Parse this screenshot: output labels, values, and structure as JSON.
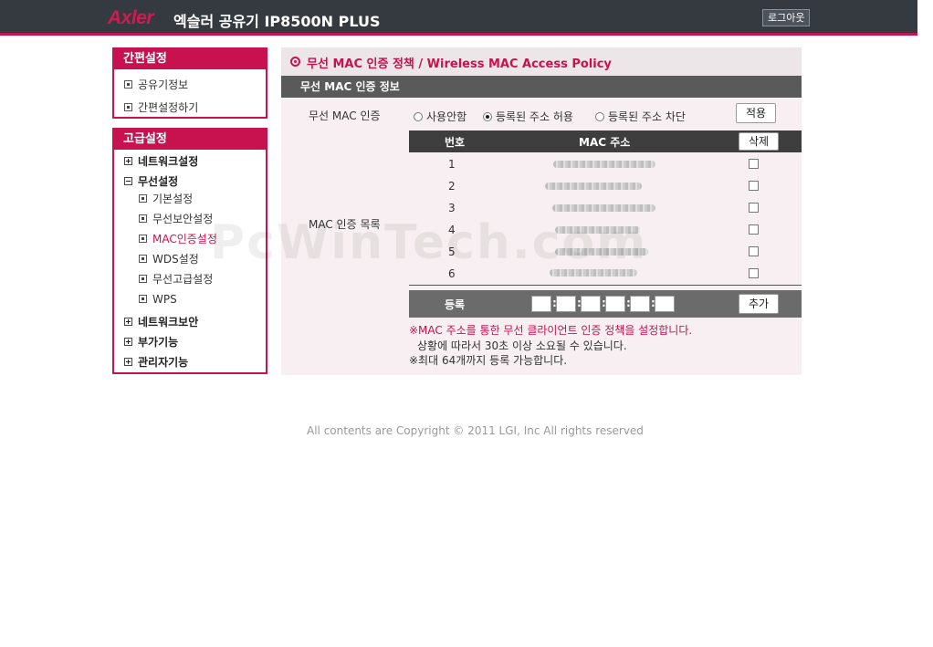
{
  "header": {
    "logo": "Axler",
    "product": "엑슬러 공유기 IP8500N PLUS",
    "logout_label": "로그아웃"
  },
  "sidebar": {
    "easy": {
      "title": "간편설정",
      "items": [
        "공유기정보",
        "간편설정하기"
      ]
    },
    "advanced": {
      "title": "고급설정",
      "network": "네트워크설정",
      "wireless": "무선설정",
      "wireless_items": [
        "기본설정",
        "무선보안설정",
        "MAC인증설정",
        "WDS설정",
        "무선고급설정",
        "WPS"
      ],
      "security": "네트워크보안",
      "extra": "부가기능",
      "admin": "관리자기능"
    },
    "active_item": "MAC인증설정"
  },
  "content": {
    "page_title": "무선 MAC 인증 정책 / Wireless MAC Access Policy",
    "section_title": "무선 MAC 인증 정보",
    "auth_label": "무선 MAC 인증",
    "radio_options": [
      "사용안함",
      "등록된 주소 허용",
      "등록된 주소 차단"
    ],
    "radio_selected": "등록된 주소 허용",
    "apply_label": "적용",
    "list_label": "MAC 인증 목록",
    "list_headers": {
      "num": "번호",
      "mac": "MAC 주소"
    },
    "delete_label": "삭제",
    "rows": [
      {
        "num": "1",
        "checked": false
      },
      {
        "num": "2",
        "checked": false
      },
      {
        "num": "3",
        "checked": false
      },
      {
        "num": "4",
        "checked": false
      },
      {
        "num": "5",
        "checked": false
      },
      {
        "num": "6",
        "checked": false
      }
    ],
    "register_label": "등록",
    "add_label": "추가",
    "notes": [
      "※MAC 주소를 통한 무선 클라이언트 인증 정책을 설정합니다.",
      "상황에 따라서 30초 이상 소요될 수 있습니다.",
      "※최대 64개까지 등록 가능합니다."
    ]
  },
  "watermark": "PcWinTech.com",
  "footer": {
    "copyright": "All contents are Copyright © 2011 LGI, Inc All rights reserved"
  },
  "colors": {
    "accent": "#c8114f",
    "header_bg": "#353a41",
    "content_bg": "#f7eff1"
  }
}
